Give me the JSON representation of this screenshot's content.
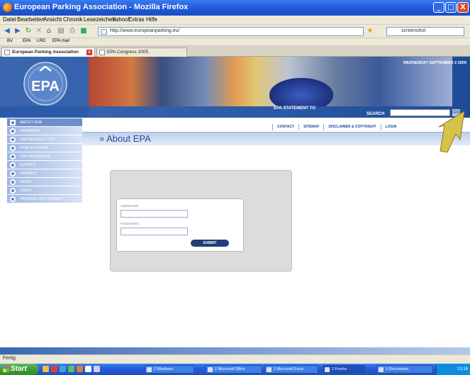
{
  "window": {
    "title": "European Parking Association - Mozilla Firefox",
    "minimize": "_",
    "maximize": "□",
    "close": "X"
  },
  "menubar": [
    "Datei",
    "Bearbeiten",
    "Ansicht",
    "Chronik",
    "Lesezeichen",
    "Yahoo!",
    "Extras",
    "Hilfe"
  ],
  "navbar": {
    "url": "http://www.europeanparking.eu/",
    "search_value": "screenshot"
  },
  "bookmarks": [
    "BV",
    "EPA",
    "LRO",
    "EPA mail"
  ],
  "tabs": [
    {
      "label": "European Parking Association",
      "active": true
    },
    {
      "label": "EPA Congress 2005",
      "active": false
    }
  ],
  "site": {
    "logo_text": "EPA",
    "date": "WEDNESDAY SEPTEMBER 2 2009",
    "statement": "EPA STATEMENT TO",
    "search_label": "SEARCH",
    "go_label": "GO",
    "top_nav": [
      "CONTACT",
      "SITEMAP",
      "DISCLAIMER & COPYRIGHT",
      "LOGIN"
    ],
    "heading": "» About EPA",
    "sidebar": [
      {
        "label": "ABOUT EPA",
        "active": true
      },
      {
        "label": "MEMBERS",
        "active": false
      },
      {
        "label": "EPA NEWSLETTER",
        "active": false
      },
      {
        "label": "PUBLICATIONS",
        "active": false
      },
      {
        "label": "EPA CONGRESS",
        "active": false
      },
      {
        "label": "EVENTS",
        "active": false
      },
      {
        "label": "AWARDS",
        "active": false
      },
      {
        "label": "NEWS",
        "active": false
      },
      {
        "label": "LINKS",
        "active": false
      },
      {
        "label": "PARKING DICTIONARY",
        "active": false
      }
    ],
    "login": {
      "username_label": "USERNAME",
      "password_label": "PASSWORD",
      "username_value": "",
      "password_value": "",
      "submit_label": "SUBMIT"
    }
  },
  "status": "Fertig",
  "taskbar": {
    "start_label": "Start",
    "items": [
      "2 Windows",
      "2 Microsoft Office",
      "2 Microsoft Excel",
      "2 Firefox",
      "3 Documents"
    ],
    "clock": "13:16"
  }
}
